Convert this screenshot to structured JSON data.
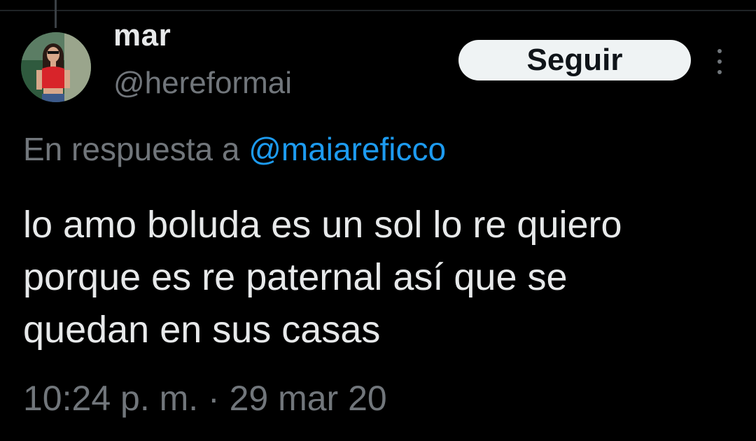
{
  "tweet": {
    "author": {
      "display_name": "mar",
      "handle": "@hereformai"
    },
    "follow_button_label": "Seguir",
    "reply_context": {
      "prefix": "En respuesta a",
      "mention": "@maiareficco"
    },
    "text_lines": [
      "lo amo boluda es un sol lo re quiero",
      "porque es re paternal así que se",
      "quedan en sus casas"
    ],
    "timestamp": "10:24 p. m. · 29 mar 20"
  },
  "icons": {
    "more": "more-vertical-icon",
    "avatar": "profile-photo"
  },
  "colors": {
    "background": "#000000",
    "primary_text": "#e7e9ea",
    "secondary_text": "#71767b",
    "link": "#1d9bf0",
    "button_bg": "#eff3f4",
    "button_text": "#0f1419"
  }
}
